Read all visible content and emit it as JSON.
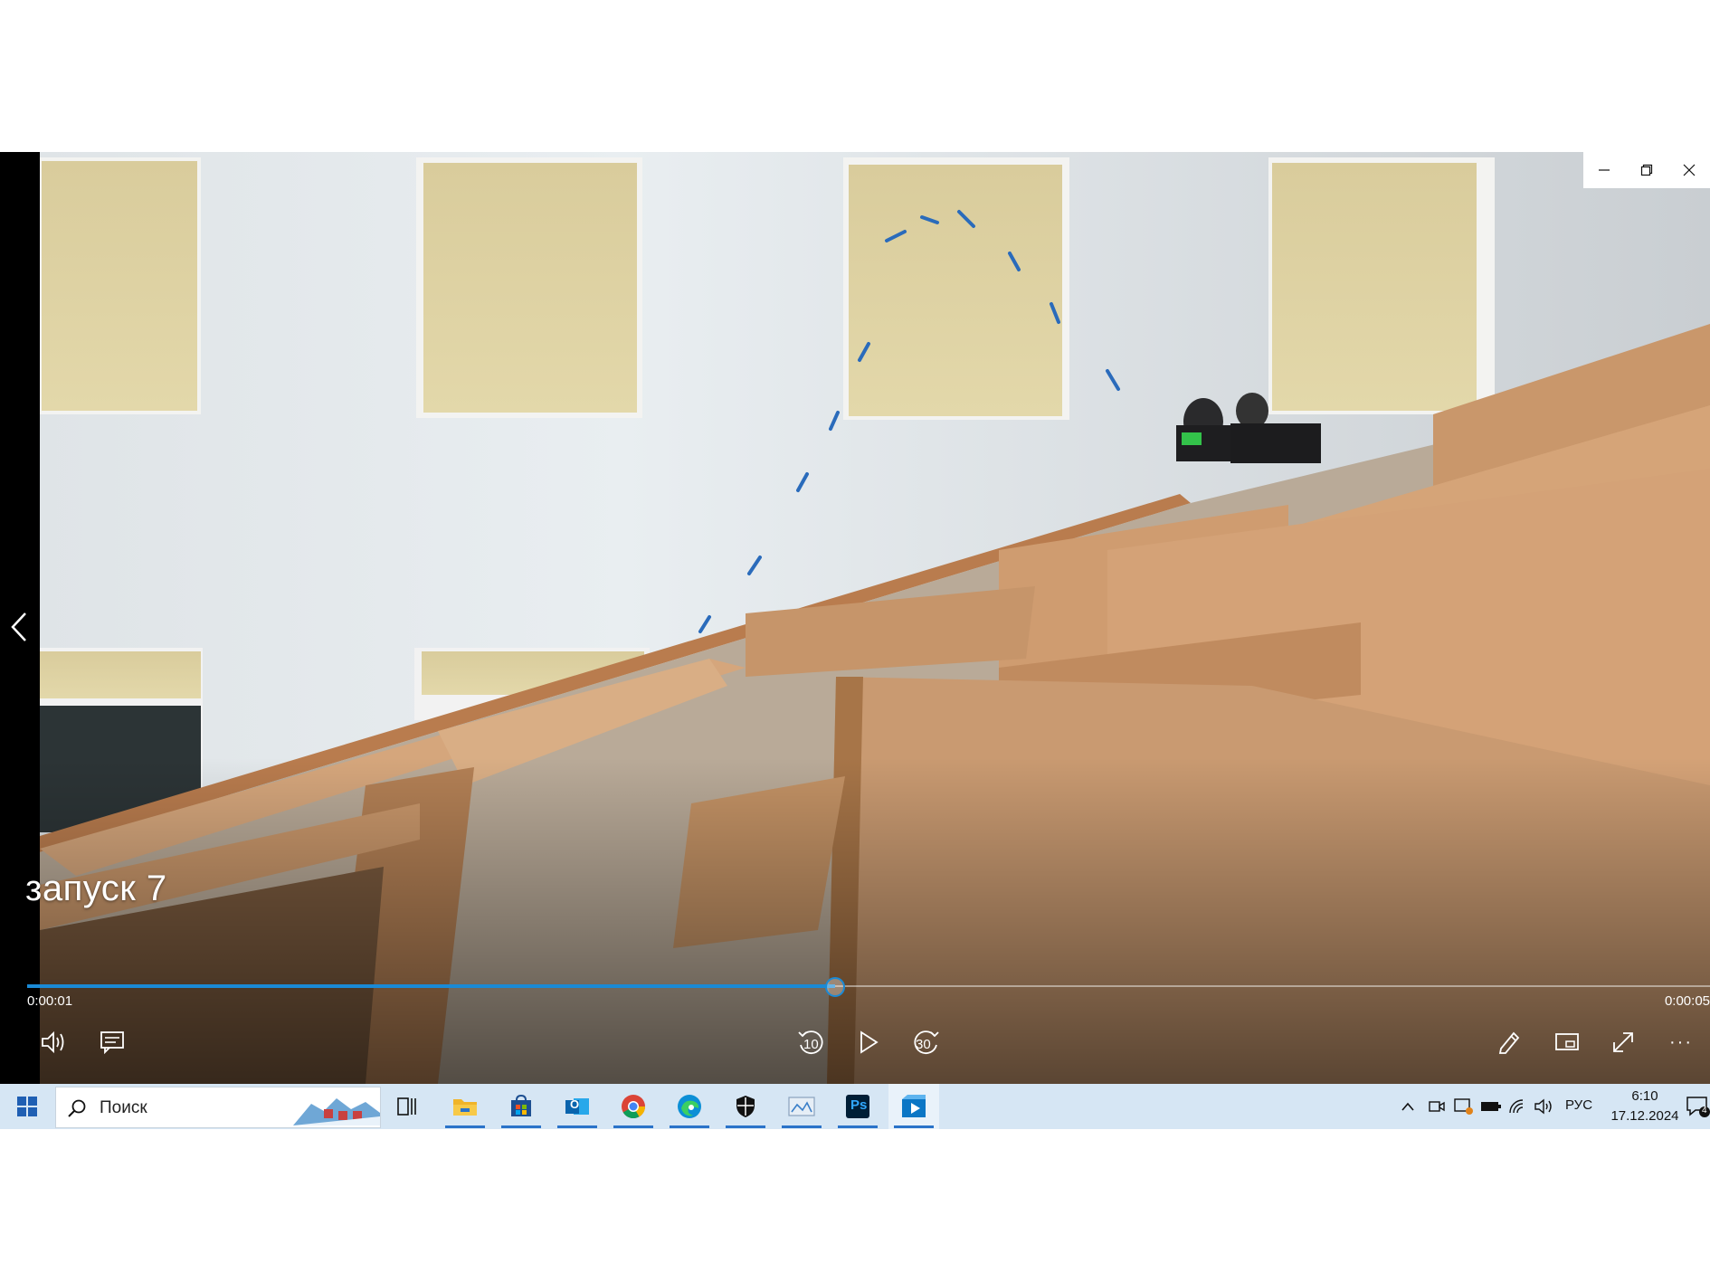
{
  "player": {
    "title": "запуск 7",
    "current_time": "0:00:01",
    "total_time": "0:00:05",
    "progress_fraction": 0.48,
    "accent_color": "#1a8ad6",
    "controls": {
      "left": [
        "volume-icon",
        "captions-icon"
      ],
      "center": [
        "skip-back-10-icon",
        "play-icon",
        "skip-forward-30-icon"
      ],
      "right": [
        "edit-pencil-icon",
        "mini-view-icon",
        "fullscreen-icon",
        "more-icon"
      ],
      "skip_back_label": "10",
      "skip_forward_label": "30",
      "more_label": "···"
    },
    "window_controls": [
      "minimize-icon",
      "restore-icon",
      "close-icon"
    ],
    "nav": "chevron-left-icon"
  },
  "taskbar": {
    "search_placeholder": "Поиск",
    "apps": [
      "task-view",
      "file-explorer",
      "microsoft-store",
      "outlook",
      "chrome",
      "edge",
      "windows-security",
      "image-viewer",
      "photoshop",
      "media-player"
    ],
    "photoshop_label": "Ps",
    "outlook_label": "O",
    "tray": [
      "chevron-up-icon",
      "meet-now-icon",
      "network-app-icon",
      "battery-icon",
      "wifi-icon",
      "speaker-icon"
    ],
    "language": "РУС",
    "time": "6:10",
    "date": "17.12.2024",
    "notification_count": "4"
  }
}
